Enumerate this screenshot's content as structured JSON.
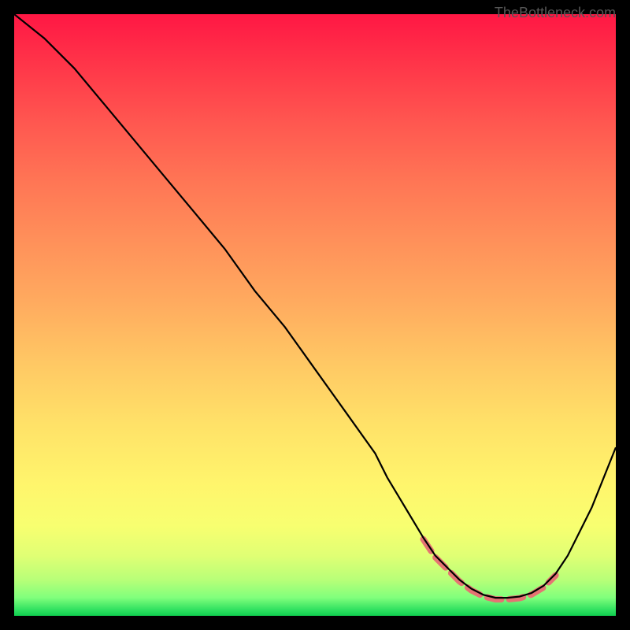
{
  "watermark": "TheBottleneck.com",
  "chart_data": {
    "type": "line",
    "title": "",
    "xlabel": "",
    "ylabel": "",
    "xlim": [
      0,
      100
    ],
    "ylim": [
      0,
      100
    ],
    "series": [
      {
        "name": "bottleneck-curve",
        "x": [
          0,
          5,
          10,
          15,
          20,
          25,
          30,
          35,
          40,
          45,
          50,
          55,
          60,
          62,
          65,
          68,
          70,
          72,
          74,
          76,
          78,
          80,
          82,
          84,
          86,
          88,
          90,
          92,
          94,
          96,
          98,
          100
        ],
        "values": [
          100,
          96,
          91,
          85,
          79,
          73,
          67,
          61,
          54,
          48,
          41,
          34,
          27,
          23,
          18,
          13,
          10,
          8,
          6,
          4.5,
          3.5,
          3,
          3,
          3.2,
          3.8,
          5,
          7,
          10,
          14,
          18,
          23,
          28
        ]
      }
    ],
    "optimal_zone": {
      "x_start": 66,
      "x_end": 90,
      "description": "dashed salmon marker indicating optimal/minimum bottleneck region"
    }
  }
}
